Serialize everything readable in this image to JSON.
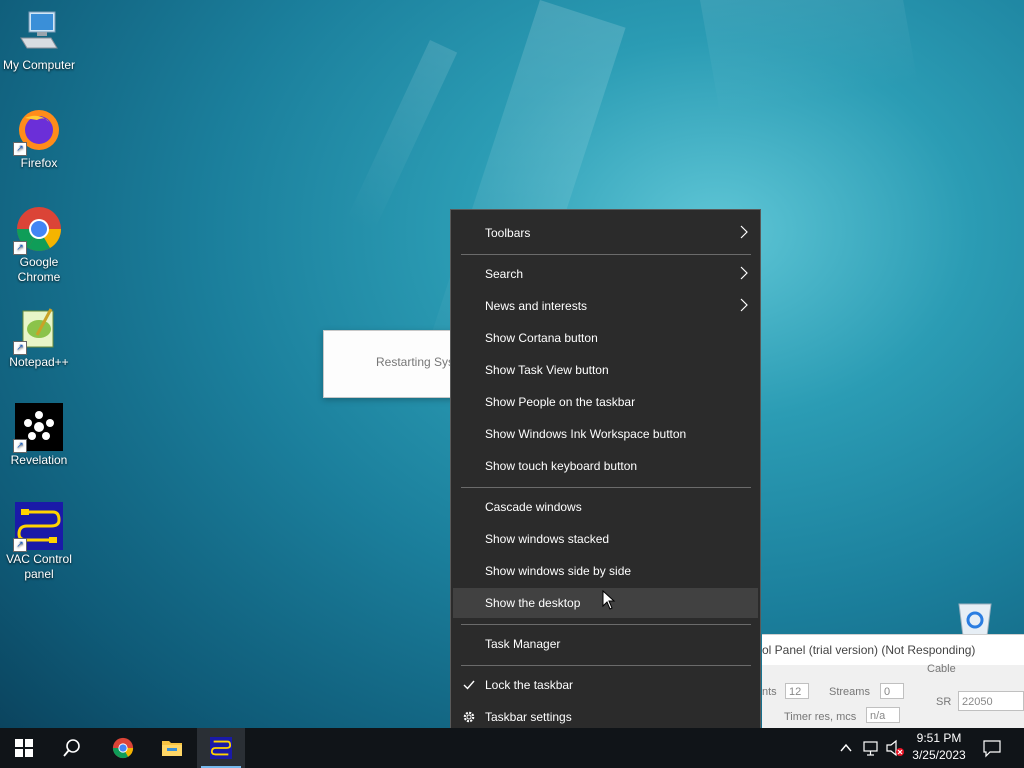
{
  "desktop": {
    "icons": [
      {
        "label": "My Computer",
        "icon": "computer-icon"
      },
      {
        "label": "Firefox",
        "icon": "firefox-icon"
      },
      {
        "label": "Google Chrome",
        "icon": "chrome-icon"
      },
      {
        "label": "Notepad++",
        "icon": "notepadpp-icon"
      },
      {
        "label": "Revelation",
        "icon": "revelation-icon"
      },
      {
        "label": "VAC Control panel",
        "icon": "vac-icon"
      }
    ]
  },
  "restart_dialog": {
    "text": "Restarting Syste"
  },
  "vac_window": {
    "title": "ol Panel (trial version) (Not Responding)",
    "cable_label": "Cable",
    "nts_label": "nts",
    "nts_value": "12",
    "streams_label": "Streams",
    "streams_value": "0",
    "sr_label": "SR",
    "sr_value": "22050",
    "timer_label": "Timer res, mcs",
    "timer_value": "n/a"
  },
  "context_menu": {
    "items": [
      {
        "label": "Toolbars",
        "submenu": true
      },
      {
        "label": "Search",
        "submenu": true
      },
      {
        "label": "News and interests",
        "submenu": true
      },
      {
        "label": "Show Cortana button"
      },
      {
        "label": "Show Task View button"
      },
      {
        "label": "Show People on the taskbar"
      },
      {
        "label": "Show Windows Ink Workspace button"
      },
      {
        "label": "Show touch keyboard button"
      },
      {
        "label": "Cascade windows"
      },
      {
        "label": "Show windows stacked"
      },
      {
        "label": "Show windows side by side"
      },
      {
        "label": "Show the desktop",
        "highlighted": true
      },
      {
        "label": "Task Manager"
      },
      {
        "label": "Lock the taskbar",
        "checked": true
      },
      {
        "label": "Taskbar settings",
        "icon": "gear-icon"
      }
    ]
  },
  "taskbar": {
    "time": "9:51 PM",
    "date": "3/25/2023",
    "buttons": [
      "start-icon",
      "search-icon",
      "chrome-icon",
      "file-explorer-icon",
      "vac-icon"
    ]
  },
  "colors": {
    "menu_bg": "#2b2b2b",
    "menu_hover": "#414141",
    "taskbar_bg": "#101418",
    "active_indicator": "#76b9ed"
  }
}
